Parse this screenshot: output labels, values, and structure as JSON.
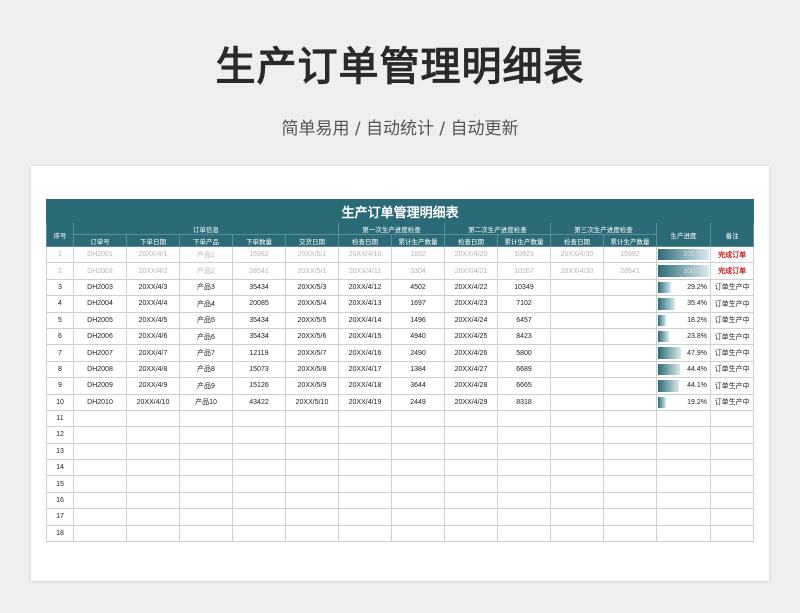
{
  "page": {
    "title": "生产订单管理明细表",
    "subtitle": "简单易用  /  自动统计  /  自动更新"
  },
  "sheet": {
    "title": "生产订单管理明细表",
    "headers": {
      "seq": "序号",
      "order_group": "订单信息",
      "check1": "第一次生产进度检查",
      "check2": "第二次生产进度检查",
      "check3": "第三次生产进度检查",
      "progress": "生产进度",
      "remark": "备注"
    },
    "subheaders": [
      "订单号",
      "下单日期",
      "下单产品",
      "下单数量",
      "交货日期",
      "检查日期",
      "累计生产数量",
      "检查日期",
      "累计生产数量",
      "检查日期",
      "累计生产数量"
    ],
    "rows": [
      {
        "no": "1",
        "order": "DH2001",
        "date": "20XX/4/1",
        "product": "产品1",
        "qty": "15982",
        "delivery": "20XX/5/1",
        "c1d": "20XX/4/10",
        "c1q": "1832",
        "c2d": "20XX/4/20",
        "c2q": "10923",
        "c3d": "20XX/4/30",
        "c3q": "15982",
        "progress": 1.0,
        "pct": "100.0%",
        "remark": "完成订单",
        "done": true
      },
      {
        "no": "2",
        "order": "DH2002",
        "date": "20XX/4/2",
        "product": "产品2",
        "qty": "28541",
        "delivery": "20XX/5/1",
        "c1d": "20XX/4/11",
        "c1q": "3304",
        "c2d": "20XX/4/21",
        "c2q": "10267",
        "c3d": "20XX/4/30",
        "c3q": "28541",
        "progress": 1.0,
        "pct": "100.0%",
        "remark": "完成订单",
        "done": true
      },
      {
        "no": "3",
        "order": "DH2003",
        "date": "20XX/4/3",
        "product": "产品3",
        "qty": "35434",
        "delivery": "20XX/5/3",
        "c1d": "20XX/4/12",
        "c1q": "4502",
        "c2d": "20XX/4/22",
        "c2q": "10349",
        "c3d": "",
        "c3q": "",
        "progress": 0.292,
        "pct": "29.2%",
        "remark": "订单生产中",
        "done": false
      },
      {
        "no": "4",
        "order": "DH2004",
        "date": "20XX/4/4",
        "product": "产品4",
        "qty": "20085",
        "delivery": "20XX/5/4",
        "c1d": "20XX/4/13",
        "c1q": "1697",
        "c2d": "20XX/4/23",
        "c2q": "7102",
        "c3d": "",
        "c3q": "",
        "progress": 0.354,
        "pct": "35.4%",
        "remark": "订单生产中",
        "done": false
      },
      {
        "no": "5",
        "order": "DH2005",
        "date": "20XX/4/5",
        "product": "产品5",
        "qty": "35434",
        "delivery": "20XX/5/5",
        "c1d": "20XX/4/14",
        "c1q": "1496",
        "c2d": "20XX/4/24",
        "c2q": "6457",
        "c3d": "",
        "c3q": "",
        "progress": 0.182,
        "pct": "18.2%",
        "remark": "订单生产中",
        "done": false
      },
      {
        "no": "6",
        "order": "DH2006",
        "date": "20XX/4/6",
        "product": "产品6",
        "qty": "35434",
        "delivery": "20XX/5/6",
        "c1d": "20XX/4/15",
        "c1q": "4940",
        "c2d": "20XX/4/25",
        "c2q": "8423",
        "c3d": "",
        "c3q": "",
        "progress": 0.238,
        "pct": "23.8%",
        "remark": "订单生产中",
        "done": false
      },
      {
        "no": "7",
        "order": "DH2007",
        "date": "20XX/4/7",
        "product": "产品7",
        "qty": "12119",
        "delivery": "20XX/5/7",
        "c1d": "20XX/4/16",
        "c1q": "2490",
        "c2d": "20XX/4/26",
        "c2q": "5800",
        "c3d": "",
        "c3q": "",
        "progress": 0.479,
        "pct": "47.9%",
        "remark": "订单生产中",
        "done": false
      },
      {
        "no": "8",
        "order": "DH2008",
        "date": "20XX/4/8",
        "product": "产品8",
        "qty": "15073",
        "delivery": "20XX/5/8",
        "c1d": "20XX/4/17",
        "c1q": "1384",
        "c2d": "20XX/4/27",
        "c2q": "6689",
        "c3d": "",
        "c3q": "",
        "progress": 0.444,
        "pct": "44.4%",
        "remark": "订单生产中",
        "done": false
      },
      {
        "no": "9",
        "order": "DH2009",
        "date": "20XX/4/9",
        "product": "产品9",
        "qty": "15126",
        "delivery": "20XX/5/9",
        "c1d": "20XX/4/18",
        "c1q": "3644",
        "c2d": "20XX/4/28",
        "c2q": "6665",
        "c3d": "",
        "c3q": "",
        "progress": 0.441,
        "pct": "44.1%",
        "remark": "订单生产中",
        "done": false
      },
      {
        "no": "10",
        "order": "DH2010",
        "date": "20XX/4/10",
        "product": "产品10",
        "qty": "43422",
        "delivery": "20XX/5/10",
        "c1d": "20XX/4/19",
        "c1q": "2449",
        "c2d": "20XX/4/29",
        "c2q": "8318",
        "c3d": "",
        "c3q": "",
        "progress": 0.192,
        "pct": "19.2%",
        "remark": "订单生产中",
        "done": false
      }
    ],
    "empty_rows": [
      "11",
      "12",
      "13",
      "14",
      "15",
      "16",
      "17",
      "18"
    ]
  }
}
